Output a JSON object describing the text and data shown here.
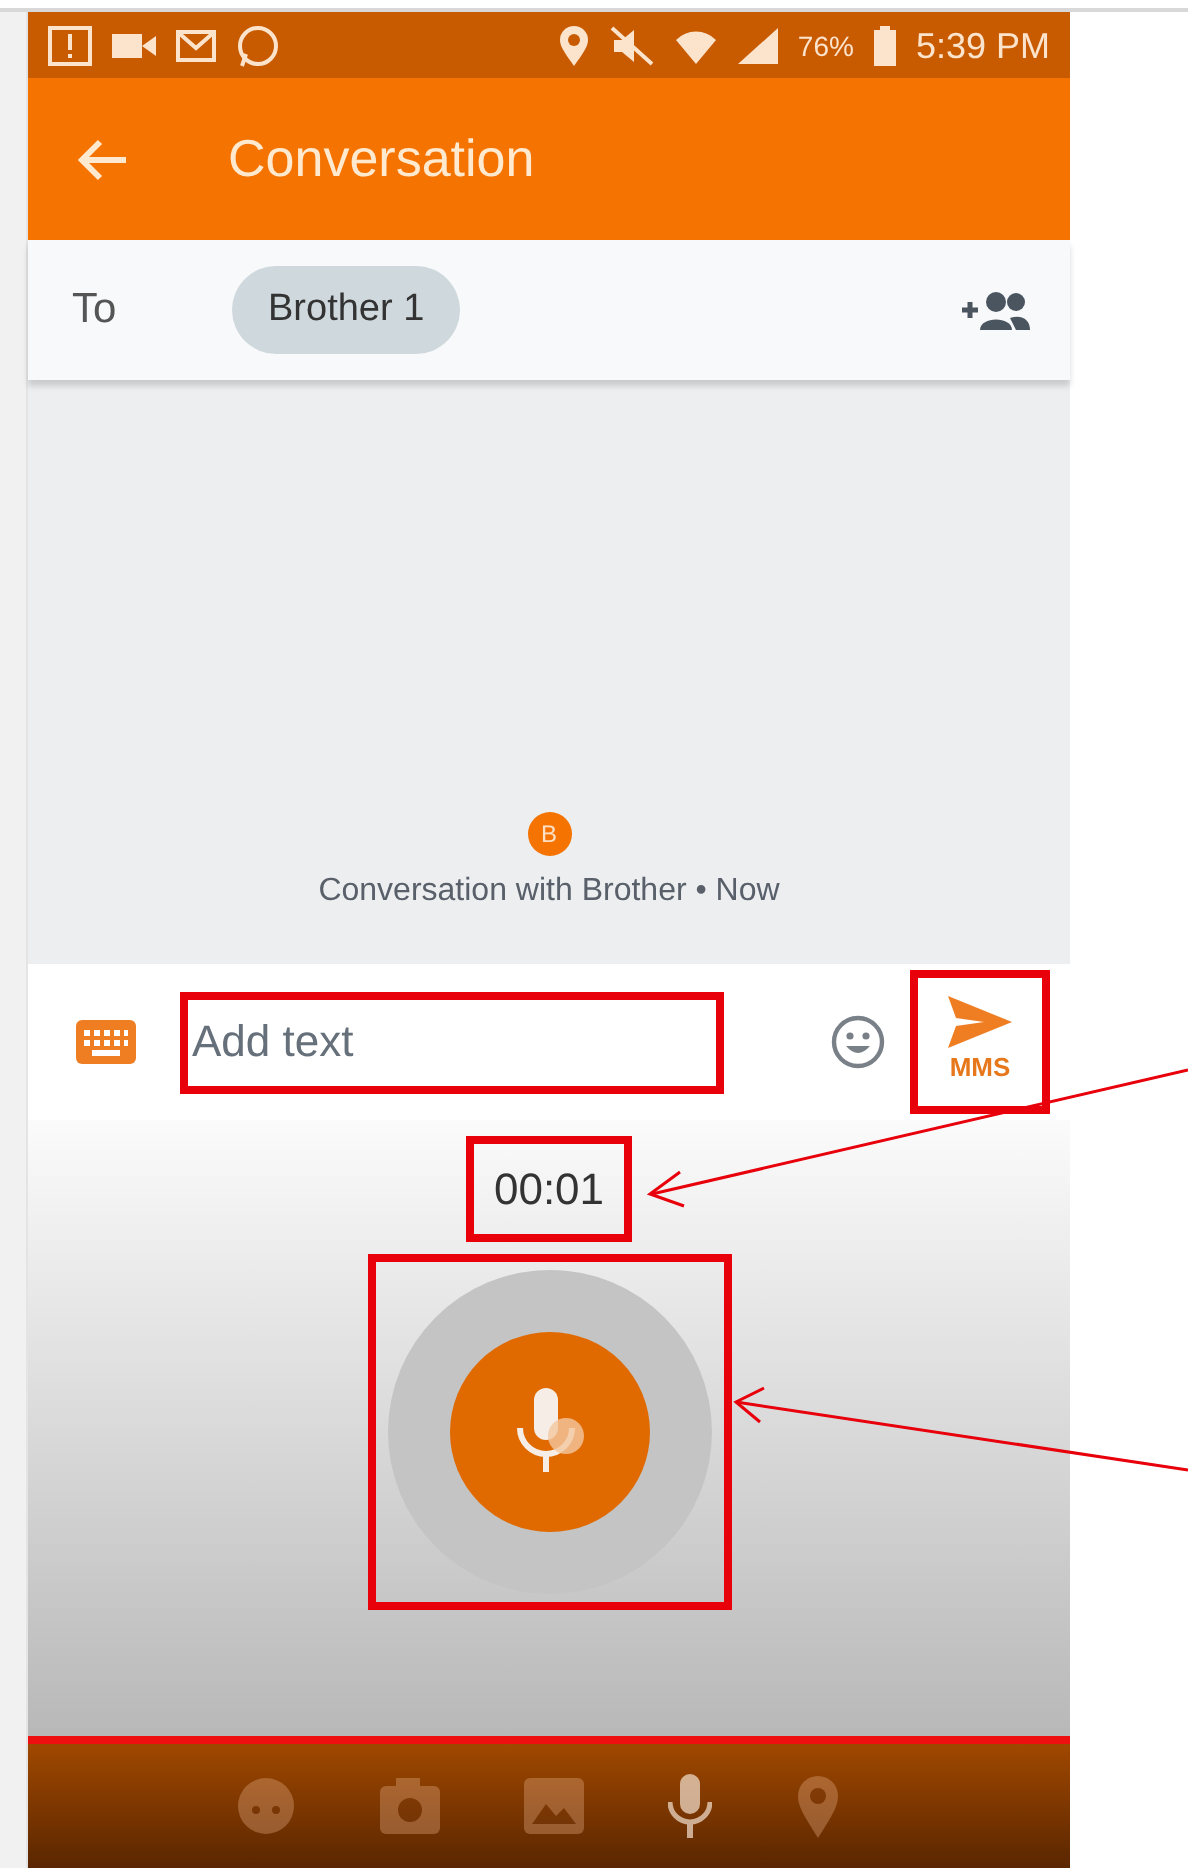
{
  "status_bar": {
    "battery": "76%",
    "time": "5:39 PM"
  },
  "app_bar": {
    "title": "Conversation"
  },
  "recipients": {
    "label": "To",
    "chips": [
      "Brother 1"
    ]
  },
  "conversation": {
    "avatar_initial": "B",
    "summary": "Conversation with Brother • Now"
  },
  "composer": {
    "placeholder": "Add text",
    "send_label": "MMS"
  },
  "recording": {
    "timer": "00:01"
  }
}
